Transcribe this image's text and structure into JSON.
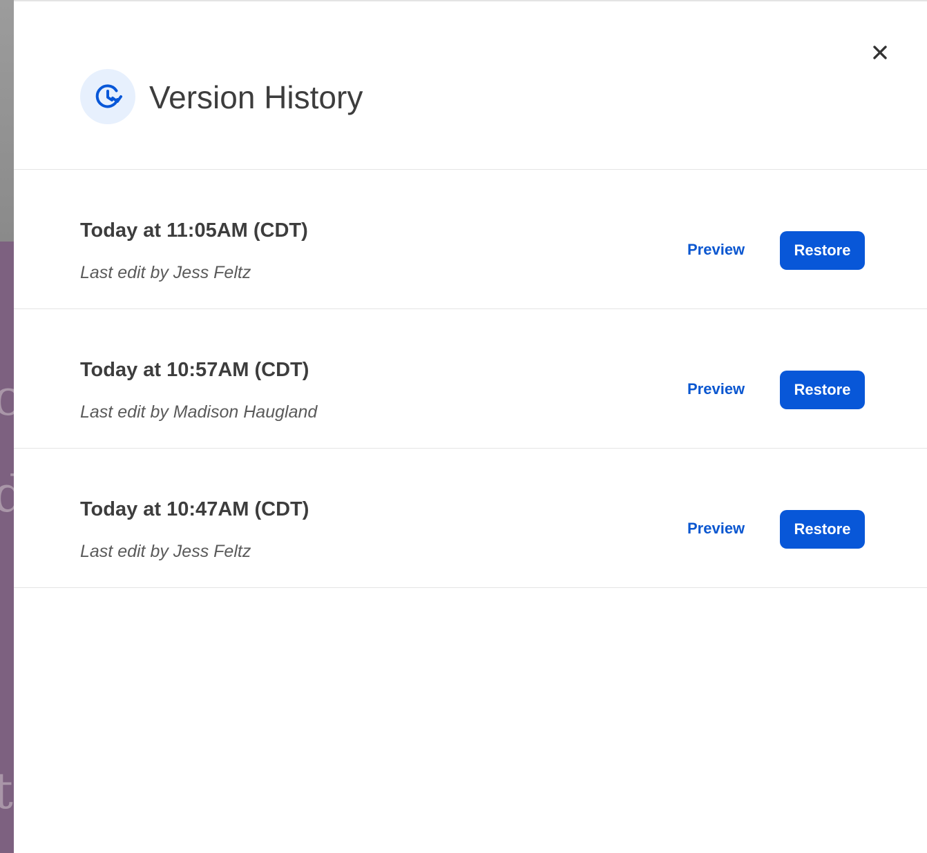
{
  "dialog": {
    "title": "Version History",
    "icon": "history-clock-icon",
    "close_icon": "close-icon",
    "accent_color": "#0857d8",
    "icon_bg_color": "#e7f0fd"
  },
  "versions": [
    {
      "timestamp": "Today at 11:05AM (CDT)",
      "editor": "Last edit by Jess Feltz",
      "preview_label": "Preview",
      "restore_label": "Restore"
    },
    {
      "timestamp": "Today at 10:57AM (CDT)",
      "editor": "Last edit by Madison Haugland",
      "preview_label": "Preview",
      "restore_label": "Restore"
    },
    {
      "timestamp": "Today at 10:47AM (CDT)",
      "editor": "Last edit by Jess Feltz",
      "preview_label": "Preview",
      "restore_label": "Restore"
    }
  ]
}
